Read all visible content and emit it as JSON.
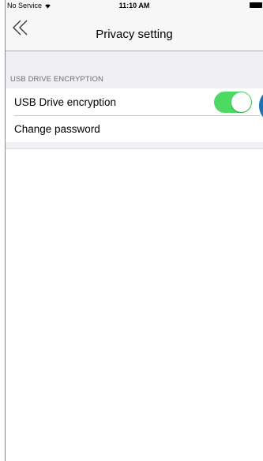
{
  "status_bar": {
    "carrier": "No Service",
    "time": "11:10 AM",
    "icons": [
      "wifi-icon",
      "battery-icon"
    ]
  },
  "nav": {
    "back_icon": "double-chevron-left-icon",
    "title": "Privacy setting"
  },
  "section": {
    "header": "USB DRIVE ENCRYPTION"
  },
  "rows": [
    {
      "label": "USB Drive encryption",
      "toggle_on": true
    },
    {
      "label": "Change password"
    }
  ],
  "colors": {
    "toggle_on": "#4cd964",
    "callout": "#1f6fb5",
    "background": "#efeff4"
  }
}
